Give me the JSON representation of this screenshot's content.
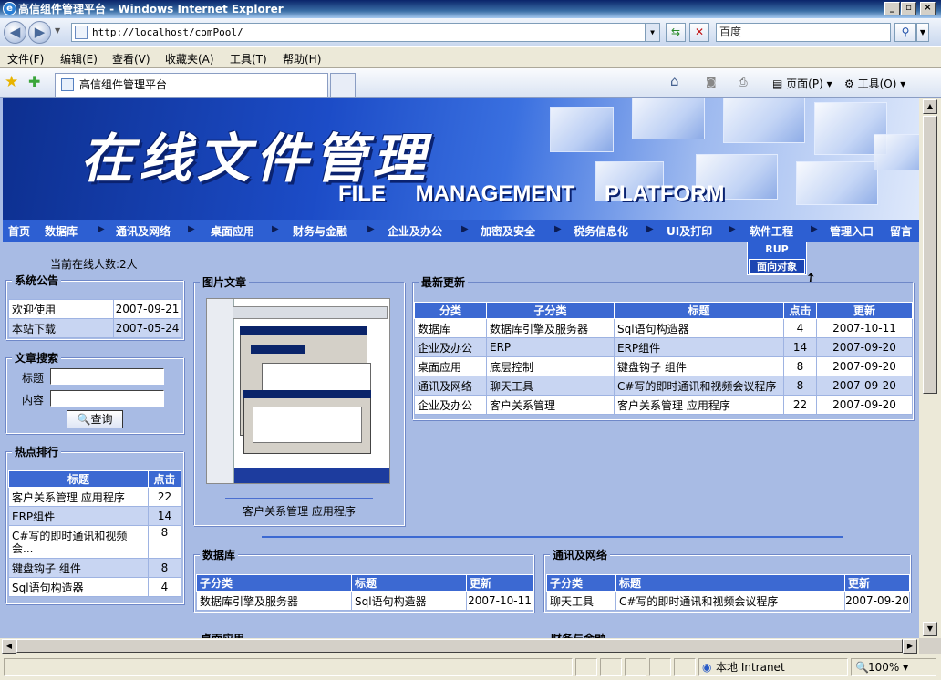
{
  "window": {
    "title": "高信组件管理平台 - Windows Internet Explorer"
  },
  "address": {
    "url": "http://localhost/comPool/",
    "search_placeholder": "百度"
  },
  "menu": [
    "文件(F)",
    "编辑(E)",
    "查看(V)",
    "收藏夹(A)",
    "工具(T)",
    "帮助(H)"
  ],
  "tab": {
    "title": "高信组件管理平台"
  },
  "toolbar": {
    "page": "页面(P)",
    "tools": "工具(O)"
  },
  "banner": {
    "title_cn": "在线文件管理",
    "title_en": "FILE MANAGEMENT PLATFORM"
  },
  "nav": [
    "首页",
    "数据库",
    "通讯及网络",
    "桌面应用",
    "财务与金融",
    "企业及办公",
    "加密及安全",
    "税务信息化",
    "UI及打印",
    "软件工程",
    "管理入口",
    "留言"
  ],
  "dropdown": [
    "RUP",
    "面向对象"
  ],
  "online": "当前在线人数:2人",
  "announce": {
    "legend": "系统公告",
    "rows": [
      [
        "欢迎使用",
        "2007-09-21"
      ],
      [
        "本站下载",
        "2007-05-24"
      ]
    ]
  },
  "search": {
    "legend": "文章搜索",
    "title_label": "标题",
    "content_label": "内容",
    "button": "查询"
  },
  "hot": {
    "legend": "热点排行",
    "headers": [
      "标题",
      "点击"
    ],
    "rows": [
      [
        "客户关系管理 应用程序",
        "22"
      ],
      [
        "ERP组件",
        "14"
      ],
      [
        "C#写的即时通讯和视频会...",
        "8"
      ],
      [
        "键盘钩子 组件",
        "8"
      ],
      [
        "Sql语句构造器",
        "4"
      ]
    ]
  },
  "picture": {
    "legend": "图片文章",
    "caption": "客户关系管理 应用程序"
  },
  "latest": {
    "legend": "最新更新",
    "headers": [
      "分类",
      "子分类",
      "标题",
      "点击",
      "更新"
    ],
    "rows": [
      [
        "数据库",
        "数据库引擎及服务器",
        "Sql语句构造器",
        "4",
        "2007-10-11"
      ],
      [
        "企业及办公",
        "ERP",
        "ERP组件",
        "14",
        "2007-09-20"
      ],
      [
        "桌面应用",
        "底层控制",
        "键盘钩子 组件",
        "8",
        "2007-09-20"
      ],
      [
        "通讯及网络",
        "聊天工具",
        "C#写的即时通讯和视频会议程序",
        "8",
        "2007-09-20"
      ],
      [
        "企业及办公",
        "客户关系管理",
        "客户关系管理 应用程序",
        "22",
        "2007-09-20"
      ]
    ]
  },
  "db": {
    "legend": "数据库",
    "headers": [
      "子分类",
      "标题",
      "更新"
    ],
    "rows": [
      [
        "数据库引擎及服务器",
        "Sql语句构造器",
        "2007-10-11"
      ]
    ]
  },
  "comm": {
    "legend": "通讯及网络",
    "headers": [
      "子分类",
      "标题",
      "更新"
    ],
    "rows": [
      [
        "聊天工具",
        "C#写的即时通讯和视频会议程序",
        "2007-09-20"
      ]
    ]
  },
  "more": [
    "桌面应用",
    "财务与金融"
  ],
  "status": {
    "zone": "本地 Intranet",
    "zoom": "100%"
  }
}
